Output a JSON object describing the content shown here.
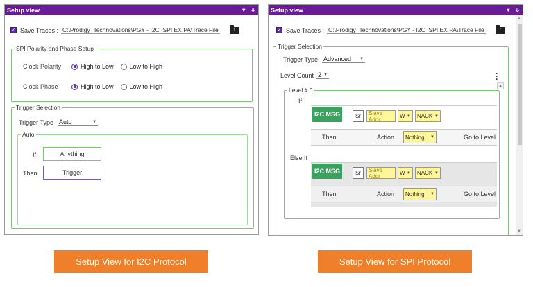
{
  "left": {
    "title": "Setup view",
    "ctrl_pin": "▾",
    "ctrl_close": "⇩",
    "save_traces_label": "Save Traces :",
    "save_traces_path": "C:\\Prodigy_Technovations\\PGY - I2C_SPI EX PA\\Trace File",
    "spi_group_label": "SPI Polarity and Phase Setup",
    "clock_polarity_label": "Clock Polarity",
    "clock_phase_label": "Clock Phase",
    "opt_high_to_low": "High to Low",
    "opt_low_to_high": "Low to High",
    "trigger_group_label": "Trigger Selection",
    "trigger_type_label": "Trigger Type",
    "trigger_type_value": "Auto",
    "auto_group_label": "Auto",
    "if_label": "If",
    "if_value": "Anything",
    "then_label": "Then",
    "then_value": "Trigger"
  },
  "right": {
    "title": "Setup view",
    "ctrl_pin": "▾",
    "ctrl_close": "⇩",
    "save_traces_label": "Save Traces :",
    "save_traces_path": "C:\\Prodigy_Technovations\\PGY - I2C_SPI EX PA\\Trace File",
    "trigger_group_label": "Trigger Selection",
    "trigger_type_label": "Trigger Type",
    "trigger_type_value": "Advanced",
    "level_count_label": "Level Count",
    "level_count_value": "2",
    "level_group_label": "Level # 0",
    "if_label": "If",
    "else_if_label": "Else If",
    "msg_button": "I2C MSG",
    "sr_label": "Sr",
    "slave_addr_placeholder": "Slave Addr",
    "rw_value": "W",
    "ack_value": "NACK",
    "then_label": "Then",
    "action_label": "Action",
    "action_value": "Nothing",
    "goto_label": "Go to Level"
  },
  "captions": {
    "left": "Setup View for I2C Protocol",
    "right": "Setup View for SPI Protocol"
  }
}
